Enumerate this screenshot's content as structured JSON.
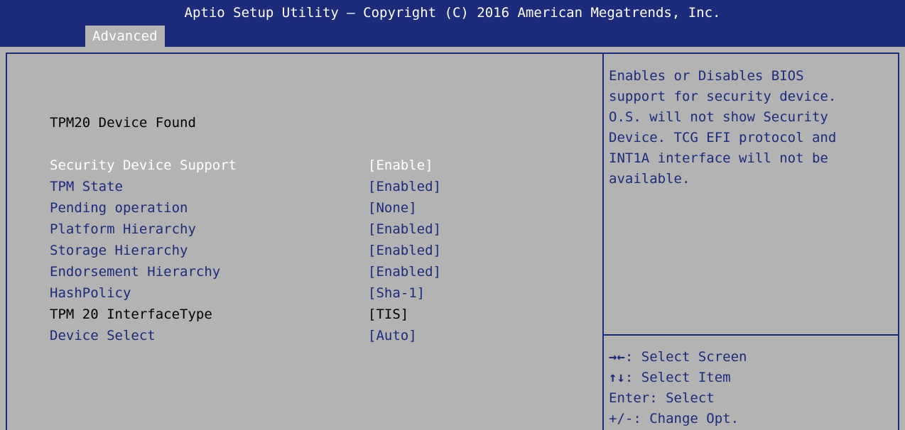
{
  "header": {
    "title": "Aptio Setup Utility – Copyright (C) 2016 American Megatrends, Inc.",
    "tab": "Advanced"
  },
  "main": {
    "info_text": "TPM20 Device Found",
    "settings": [
      {
        "label": "Security Device Support",
        "value": "[Enable]",
        "state": "selected"
      },
      {
        "label": "TPM State",
        "value": "[Enabled]",
        "state": "enabled"
      },
      {
        "label": "Pending operation",
        "value": "[None]",
        "state": "enabled"
      },
      {
        "label": "Platform Hierarchy",
        "value": "[Enabled]",
        "state": "enabled"
      },
      {
        "label": "Storage Hierarchy",
        "value": "[Enabled]",
        "state": "enabled"
      },
      {
        "label": "Endorsement Hierarchy",
        "value": "[Enabled]",
        "state": "enabled"
      },
      {
        "label": "HashPolicy",
        "value": "[Sha-1]",
        "state": "enabled"
      },
      {
        "label": "TPM 20 InterfaceType",
        "value": "[TIS]",
        "state": "readonly"
      },
      {
        "label": "Device Select",
        "value": "[Auto]",
        "state": "enabled"
      }
    ]
  },
  "help": {
    "lines": [
      "Enables or Disables BIOS",
      "support for security device.",
      "O.S. will not show Security",
      "Device. TCG EFI protocol and",
      "INT1A interface will not be",
      "available."
    ]
  },
  "keys": [
    {
      "glyph": "→←",
      "text": ": Select Screen"
    },
    {
      "glyph": "↑↓",
      "text": ": Select Item"
    },
    {
      "glyph": "",
      "text": "Enter: Select"
    },
    {
      "glyph": "",
      "text": "+/-: Change Opt."
    }
  ],
  "colors": {
    "frame": "#1d2b7b",
    "panel": "#b3b3b3",
    "highlight": "#ffffff"
  }
}
